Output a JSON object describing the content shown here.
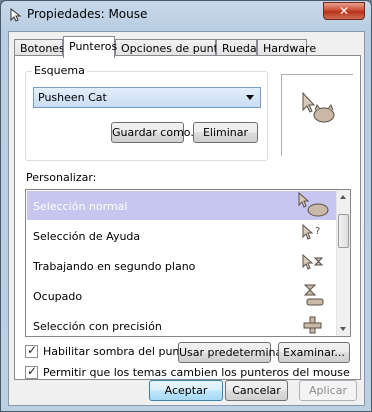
{
  "window": {
    "title": "Propiedades: Mouse",
    "close_label": "✕"
  },
  "tabs": [
    {
      "label": "Botones"
    },
    {
      "label": "Punteros"
    },
    {
      "label": "Opciones de puntero"
    },
    {
      "label": "Rueda"
    },
    {
      "label": "Hardware"
    }
  ],
  "active_tab": "Punteros",
  "scheme": {
    "legend": "Esquema",
    "selected": "Pusheen Cat",
    "save_as_label": "Guardar como...",
    "delete_label": "Eliminar"
  },
  "customize": {
    "label": "Personalizar:",
    "items": [
      {
        "label": "Selección normal",
        "selected": true,
        "icon": "arrow-cat-icon"
      },
      {
        "label": "Selección de Ayuda",
        "selected": false,
        "icon": "help-arrow-icon"
      },
      {
        "label": "Trabajando en segundo plano",
        "selected": false,
        "icon": "background-working-icon"
      },
      {
        "label": "Ocupado",
        "selected": false,
        "icon": "hourglass-icon"
      },
      {
        "label": "Selección con precisión",
        "selected": false,
        "icon": "crosshair-icon"
      }
    ]
  },
  "options": {
    "shadow_label": "Habilitar sombra del puntero",
    "shadow_checked": true,
    "themes_label": "Permitir que los temas cambien los punteros del mouse",
    "themes_checked": true,
    "use_default_label": "Usar predeterminado",
    "browse_label": "Examinar..."
  },
  "footer": {
    "accept_label": "Aceptar",
    "cancel_label": "Cancelar",
    "apply_label": "Aplicar"
  },
  "colors": {
    "selection": "#c6c6f0",
    "cursor_tan": "#c9b9a6",
    "cursor_dark": "#5a5048"
  }
}
